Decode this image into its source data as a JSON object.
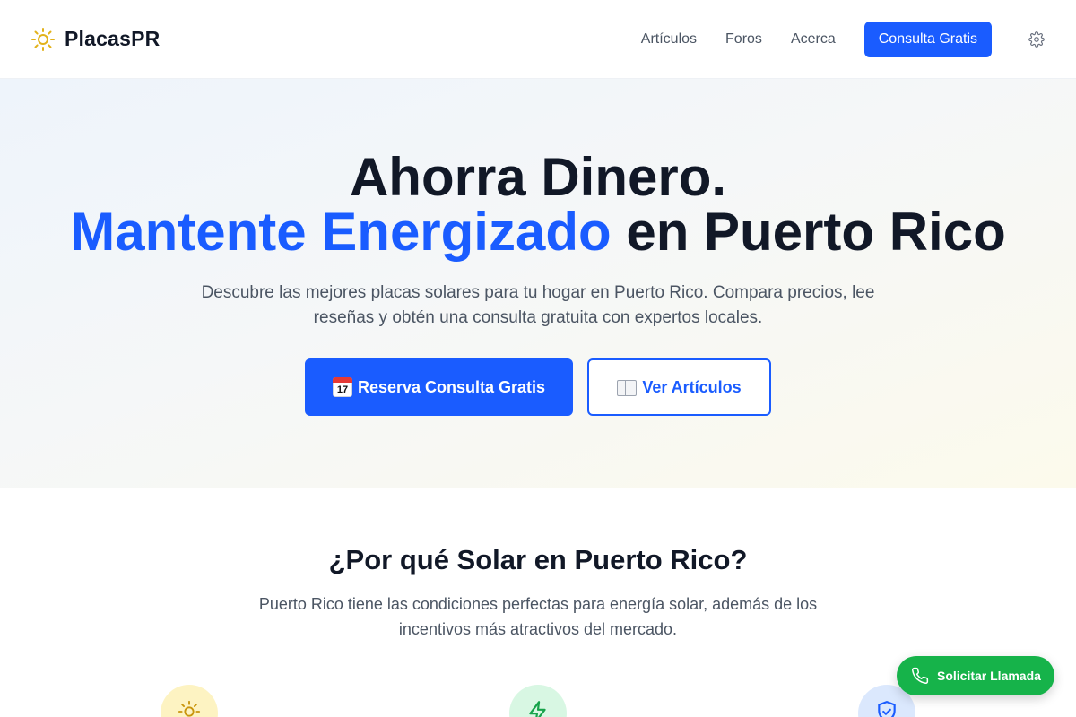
{
  "header": {
    "brand": "PlacasPR",
    "logo_icon": "sun-icon",
    "nav": [
      "Artículos",
      "Foros",
      "Acerca"
    ],
    "cta": "Consulta Gratis",
    "settings_icon": "gear-icon"
  },
  "hero": {
    "line1": "Ahorra Dinero.",
    "line2_accent": "Mantente Energizado",
    "line2_rest": " en Puerto Rico",
    "subtitle": "Descubre las mejores placas solares para tu hogar en Puerto Rico. Compara precios, lee reseñas y obtén una consulta gratuita con expertos locales.",
    "primary_button": "Reserva Consulta Gratis",
    "primary_icon": "calendar-icon",
    "secondary_button": "Ver Artículos",
    "secondary_icon": "book-icon"
  },
  "why": {
    "title": "¿Por qué Solar en Puerto Rico?",
    "subtitle": "Puerto Rico tiene las condiciones perfectas para energía solar, además de los incentivos más atractivos del mercado.",
    "feature_icons": [
      "sun-icon",
      "lightning-icon",
      "shield-check-icon"
    ]
  },
  "floating": {
    "call_label": "Solicitar Llamada",
    "call_icon": "phone-icon"
  },
  "colors": {
    "accent": "#1a5cff",
    "call_green": "#16b34a",
    "sun": "#e2b21b"
  }
}
